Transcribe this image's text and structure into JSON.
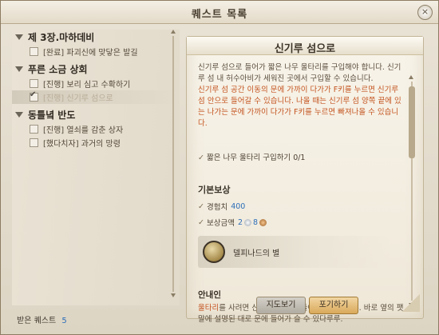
{
  "window": {
    "title": "퀘스트 목록",
    "close_icon": "×"
  },
  "quest_list": {
    "groups": [
      {
        "title": "제 3장.마하데비",
        "items": [
          {
            "label": "[완료] 파괴신에 맞닿은 발길",
            "checked": false,
            "selected": false
          }
        ]
      },
      {
        "title": "푸른 소금 상회",
        "items": [
          {
            "label": "[진행] 보리 심고 수확하기",
            "checked": false,
            "selected": false
          },
          {
            "label": "[진행] 신기루 섬으로",
            "checked": true,
            "selected": true
          }
        ]
      },
      {
        "title": "동틀녘 반도",
        "items": [
          {
            "label": "[진행] 열쇠를 감춘 상자",
            "checked": false,
            "selected": false
          },
          {
            "label": "[했다치자] 과거의 망령",
            "checked": false,
            "selected": false
          }
        ]
      }
    ],
    "accepted_label": "받은 퀘스트",
    "accepted_count": "5"
  },
  "detail": {
    "title": "신기루 섬으로",
    "desc1": "신기루 섬으로 들어가 짧은 나무 울타리를 구입해야 합니다. 신기루 섬 내 허수아비가 세워진 곳에서 구입할 수 있습니다.",
    "desc2": "신기루 섬 공간 이동의 문에 가까이 다가가 F키를 누르면 신기루 섬 안으로 들어갈 수 있습니다. 나올 때는 신기루 섬 양쪽 끝에 있는 나가는 문에 가까이 다가가 F키를 누르면 빠져나올 수 있습니다.",
    "objective": "짧은 나무 울타리 구입하기 0/1",
    "reward_head": "기본보상",
    "exp_label": "경험치",
    "exp_value": "400",
    "money_label": "보상금액",
    "money_silver": "2",
    "money_copper": "8",
    "reward_item": "델피나드의 별",
    "guide_head": "안내인",
    "guide_text_red": "울타리",
    "guide_text": "를 사려면 신기루 섬 안에 들어가야 한다루루. 바로 옆의 팻말에 설명된 대로 문에 들어가 슬 수 있다루루.",
    "map_button": "지도보기",
    "abandon_button": "포기하기"
  },
  "colors": {
    "accent_red": "#c4541f",
    "accent_blue": "#2d6fb8"
  }
}
